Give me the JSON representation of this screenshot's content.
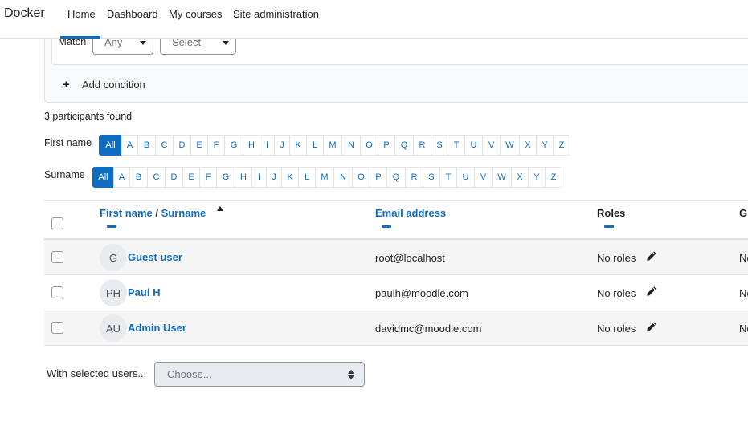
{
  "navbar": {
    "brand": "Docker",
    "items": [
      {
        "label": "Home"
      },
      {
        "label": "Dashboard"
      },
      {
        "label": "My courses"
      },
      {
        "label": "Site administration"
      }
    ]
  },
  "filter": {
    "match_label": "Match",
    "match_value": "Any",
    "type_value": "Select",
    "add_condition": "Add condition"
  },
  "participants_found": "3 participants found",
  "first_name_filter": {
    "label": "First name",
    "letters": [
      "All",
      "A",
      "B",
      "C",
      "D",
      "E",
      "F",
      "G",
      "H",
      "I",
      "J",
      "K",
      "L",
      "M",
      "N",
      "O",
      "P",
      "Q",
      "R",
      "S",
      "T",
      "U",
      "V",
      "W",
      "X",
      "Y",
      "Z"
    ],
    "selected": "All"
  },
  "surname_filter": {
    "label": "Surname",
    "letters": [
      "All",
      "A",
      "B",
      "C",
      "D",
      "E",
      "F",
      "G",
      "H",
      "I",
      "J",
      "K",
      "L",
      "M",
      "N",
      "O",
      "P",
      "Q",
      "R",
      "S",
      "T",
      "U",
      "V",
      "W",
      "X",
      "Y",
      "Z"
    ],
    "selected": "All"
  },
  "table": {
    "headers": {
      "first_name": "First name",
      "separator": "/",
      "surname": "Surname",
      "email": "Email address",
      "roles": "Roles",
      "groups": "G"
    },
    "rows": [
      {
        "initials": "G",
        "name": "Guest user",
        "email": "root@localhost",
        "roles": "No roles",
        "groups": "No"
      },
      {
        "initials": "PH",
        "name": "Paul H",
        "email": "paulh@moodle.com",
        "roles": "No roles",
        "groups": "No"
      },
      {
        "initials": "AU",
        "name": "Admin User",
        "email": "davidmc@moodle.com",
        "roles": "No roles",
        "groups": "No"
      }
    ]
  },
  "bulk": {
    "label": "With selected users...",
    "placeholder": "Choose..."
  },
  "colors": {
    "accent": "#0f6cbf",
    "text": "#1d2125",
    "border": "#dee2e6"
  }
}
